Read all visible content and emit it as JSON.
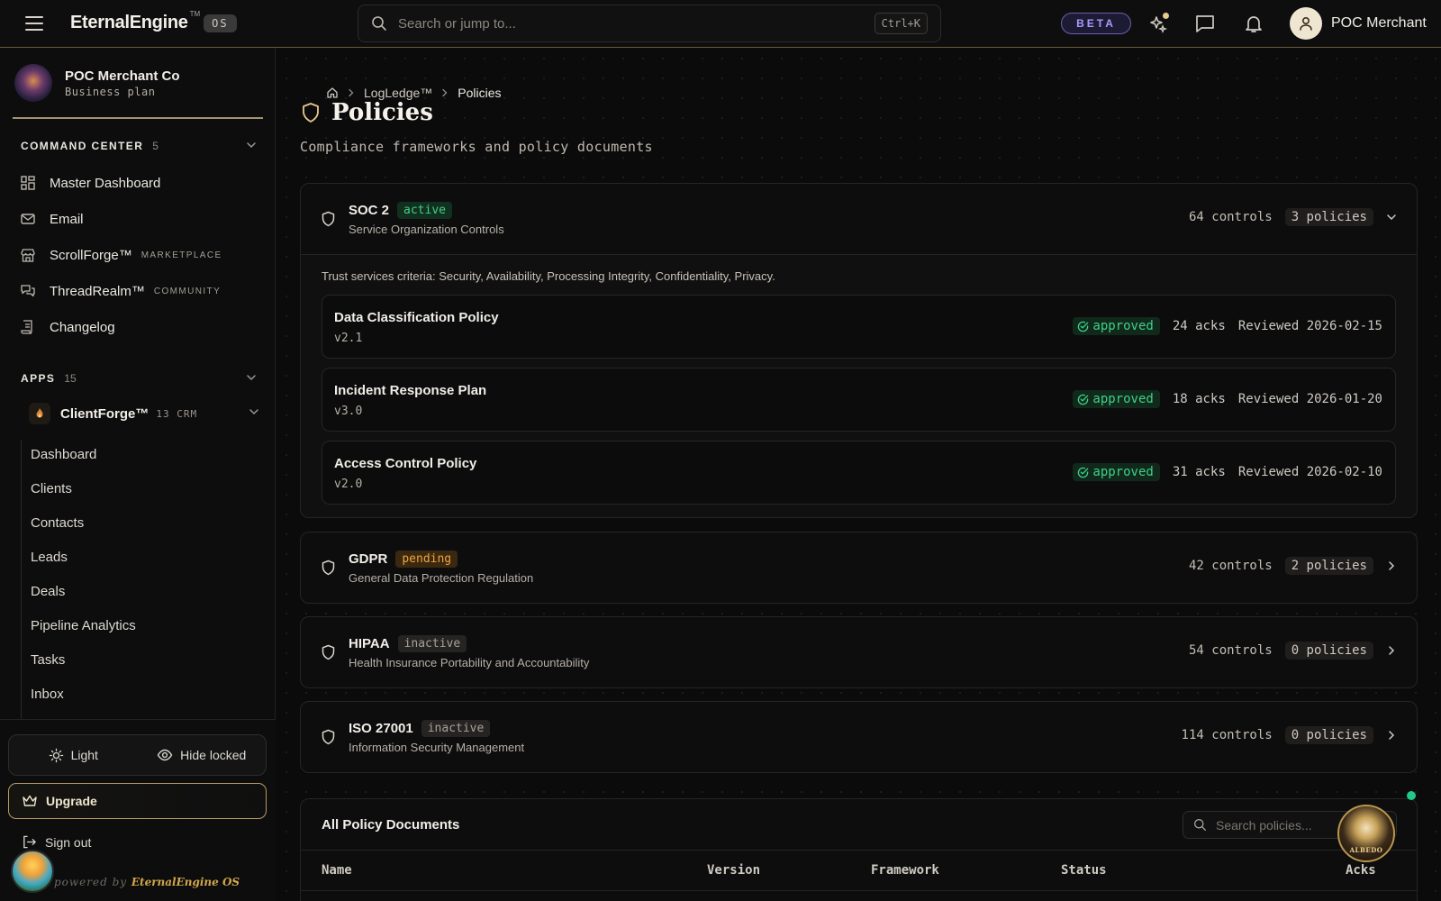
{
  "topbar": {
    "brand": "EternalEngine",
    "brand_tm": "TM",
    "brand_os": "OS",
    "search_placeholder": "Search or jump to...",
    "shortcut": "Ctrl+K",
    "beta": "BETA",
    "user_name": "POC Merchant",
    "icons": [
      "menu-icon",
      "search-icon",
      "sparkle-icon",
      "chat-icon",
      "bell-icon",
      "user-icon"
    ]
  },
  "sidebar": {
    "org_name": "POC Merchant Co",
    "org_plan": "Business plan",
    "command_center": {
      "label": "COMMAND CENTER",
      "count": "5",
      "items": [
        {
          "label": "Master Dashboard",
          "icon": "dashboard-icon",
          "tag": ""
        },
        {
          "label": "Email",
          "icon": "mail-icon",
          "tag": ""
        },
        {
          "label": "ScrollForge™",
          "icon": "store-icon",
          "tag": "MARKETPLACE"
        },
        {
          "label": "ThreadRealm™",
          "icon": "messages-icon",
          "tag": "COMMUNITY"
        },
        {
          "label": "Changelog",
          "icon": "scroll-icon",
          "tag": ""
        }
      ]
    },
    "apps": {
      "label": "APPS",
      "count": "15",
      "app_name": "ClientForge™",
      "app_meta": "13 CRM",
      "sub_items": [
        "Dashboard",
        "Clients",
        "Contacts",
        "Leads",
        "Deals",
        "Pipeline Analytics",
        "Tasks",
        "Inbox"
      ]
    },
    "light_label": "Light",
    "hide_locked_label": "Hide locked",
    "upgrade_label": "Upgrade",
    "signout_label": "Sign out",
    "powered_prefix": "powered by",
    "powered_brand": "EternalEngine OS"
  },
  "main": {
    "breadcrumbs": [
      "LogLedge™",
      "Policies"
    ],
    "title": "Policies",
    "subtitle": "Compliance frameworks and policy documents",
    "frameworks": [
      {
        "name": "SOC 2",
        "status": "active",
        "description": "Service Organization Controls",
        "controls": "64 controls",
        "policies": "3 policies",
        "expanded": true,
        "criteria": "Trust services criteria: Security, Availability, Processing Integrity, Confidentiality, Privacy.",
        "documents": [
          {
            "name": "Data Classification Policy",
            "version": "v2.1",
            "status": "approved",
            "acks": "24 acks",
            "reviewed": "Reviewed 2026-02-15"
          },
          {
            "name": "Incident Response Plan",
            "version": "v3.0",
            "status": "approved",
            "acks": "18 acks",
            "reviewed": "Reviewed 2026-01-20"
          },
          {
            "name": "Access Control Policy",
            "version": "v2.0",
            "status": "approved",
            "acks": "31 acks",
            "reviewed": "Reviewed 2026-02-10"
          }
        ]
      },
      {
        "name": "GDPR",
        "status": "pending",
        "description": "General Data Protection Regulation",
        "controls": "42 controls",
        "policies": "2 policies",
        "expanded": false
      },
      {
        "name": "HIPAA",
        "status": "inactive",
        "description": "Health Insurance Portability and Accountability",
        "controls": "54 controls",
        "policies": "0 policies",
        "expanded": false
      },
      {
        "name": "ISO 27001",
        "status": "inactive",
        "description": "Information Security Management",
        "controls": "114 controls",
        "policies": "0 policies",
        "expanded": false
      }
    ],
    "all_docs": {
      "title": "All Policy Documents",
      "search_placeholder": "Search policies...",
      "columns": [
        "Name",
        "Version",
        "Framework",
        "Status",
        "Acks"
      ]
    },
    "assistant_label": "ALBEDO"
  },
  "colors": {
    "accent_gold": "#c9b58a",
    "active_green": "#3fd08a",
    "pending_orange": "#f0a43a",
    "beta_purple": "#a79cff"
  }
}
